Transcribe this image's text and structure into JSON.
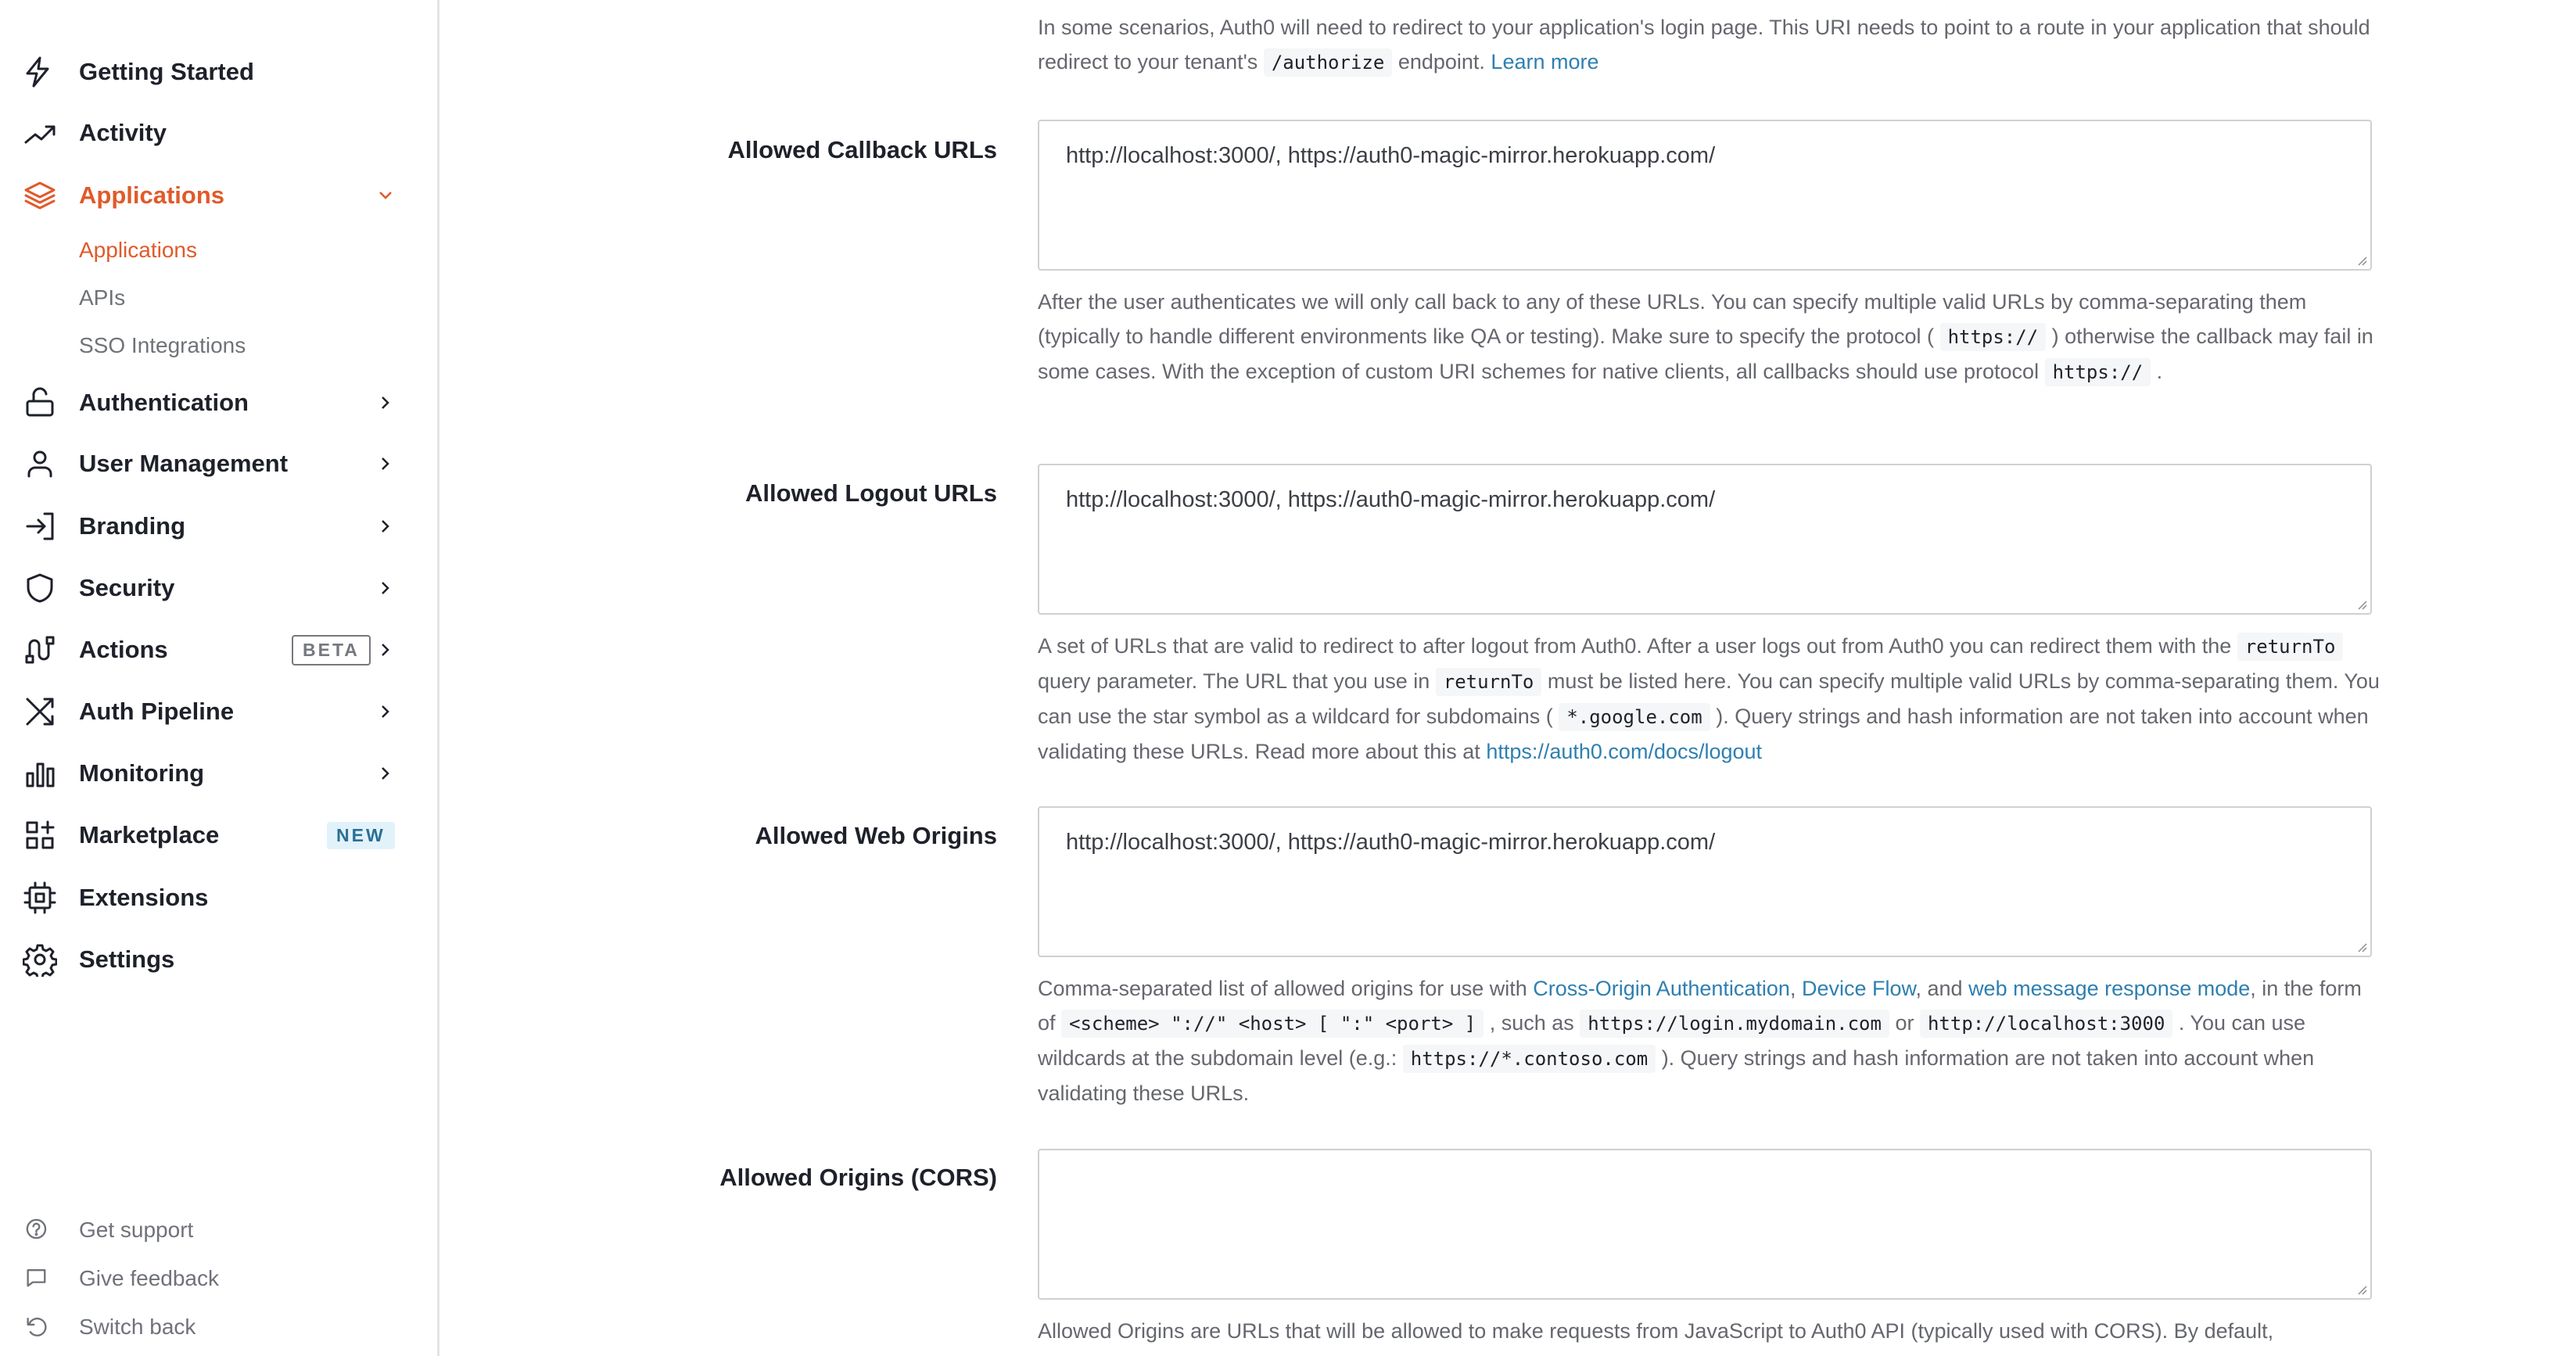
{
  "sidebar": {
    "items": [
      {
        "label": "Getting Started",
        "icon": "lightning-icon"
      },
      {
        "label": "Activity",
        "icon": "trending-up-icon"
      },
      {
        "label": "Applications",
        "icon": "layers-icon",
        "active": true
      },
      {
        "label": "Authentication",
        "icon": "lock-icon"
      },
      {
        "label": "User Management",
        "icon": "user-icon"
      },
      {
        "label": "Branding",
        "icon": "login-arrow-icon"
      },
      {
        "label": "Security",
        "icon": "shield-icon"
      },
      {
        "label": "Actions",
        "icon": "actions-flow-icon",
        "badge": "BETA"
      },
      {
        "label": "Auth Pipeline",
        "icon": "shuffle-icon"
      },
      {
        "label": "Monitoring",
        "icon": "bar-chart-icon"
      },
      {
        "label": "Marketplace",
        "icon": "grid-plus-icon",
        "badge": "NEW"
      },
      {
        "label": "Extensions",
        "icon": "chip-icon"
      },
      {
        "label": "Settings",
        "icon": "gear-icon"
      }
    ],
    "subitems": [
      {
        "label": "Applications",
        "active": true
      },
      {
        "label": "APIs"
      },
      {
        "label": "SSO Integrations"
      }
    ],
    "footer": [
      {
        "label": "Get support",
        "icon": "help-circle-icon"
      },
      {
        "label": "Give feedback",
        "icon": "message-icon"
      },
      {
        "label": "Switch back",
        "icon": "undo-icon"
      }
    ],
    "accent": "#e05a2a"
  },
  "main": {
    "intro": [
      {
        "t": "In some scenarios, Auth0 will need to redirect to your application's login page. This URI needs to point to a route in your application that should redirect to your tenant's "
      },
      {
        "t": "/authorize",
        "type": "code"
      },
      {
        "t": " endpoint. "
      },
      {
        "t": "Learn more",
        "type": "link"
      }
    ],
    "fields": [
      {
        "label": "Allowed Callback URLs",
        "value": "http://localhost:3000/, https://auth0-magic-mirror.herokuapp.com/",
        "description": [
          {
            "t": "After the user authenticates we will only call back to any of these URLs. You can specify multiple valid URLs by comma-separating them (typically to handle different environments like QA or testing). Make sure to specify the protocol ( "
          },
          {
            "t": "https://",
            "type": "code"
          },
          {
            "t": " ) otherwise the callback may fail in some cases. With the exception of custom URI schemes for native clients, all callbacks should use protocol "
          },
          {
            "t": "https://",
            "type": "code"
          },
          {
            "t": " ."
          }
        ]
      },
      {
        "label": "Allowed Logout URLs",
        "value": "http://localhost:3000/, https://auth0-magic-mirror.herokuapp.com/",
        "description": [
          {
            "t": "A set of URLs that are valid to redirect to after logout from Auth0. After a user logs out from Auth0 you can redirect them with the "
          },
          {
            "t": "returnTo",
            "type": "code"
          },
          {
            "t": " query parameter. The URL that you use in "
          },
          {
            "t": "returnTo",
            "type": "code"
          },
          {
            "t": " must be listed here. You can specify multiple valid URLs by comma-separating them. You can use the star symbol as a wildcard for subdomains ( "
          },
          {
            "t": "*.google.com",
            "type": "code"
          },
          {
            "t": " ). Query strings and hash information are not taken into account when validating these URLs. Read more about this at "
          },
          {
            "t": "https://auth0.com/docs/logout",
            "type": "link"
          }
        ]
      },
      {
        "label": "Allowed Web Origins",
        "value": "http://localhost:3000/, https://auth0-magic-mirror.herokuapp.com/",
        "description": [
          {
            "t": "Comma-separated list of allowed origins for use with "
          },
          {
            "t": "Cross-Origin Authentication",
            "type": "link"
          },
          {
            "t": ", "
          },
          {
            "t": "Device Flow",
            "type": "link"
          },
          {
            "t": ", and "
          },
          {
            "t": "web message response mode",
            "type": "link"
          },
          {
            "t": ", in the form of "
          },
          {
            "t": "<scheme> \"://\" <host> [ \":\" <port> ]",
            "type": "code"
          },
          {
            "t": " , such as "
          },
          {
            "t": "https://login.mydomain.com",
            "type": "code"
          },
          {
            "t": " or "
          },
          {
            "t": "http://localhost:3000",
            "type": "code"
          },
          {
            "t": " . You can use wildcards at the subdomain level (e.g.: "
          },
          {
            "t": "https://*.contoso.com",
            "type": "code"
          },
          {
            "t": " ). Query strings and hash information are not taken into account when validating these URLs."
          }
        ]
      },
      {
        "label": "Allowed Origins (CORS)",
        "value": "",
        "description": [
          {
            "t": "Allowed Origins are URLs that will be allowed to make requests from JavaScript to Auth0 API (typically used with CORS). By default,"
          }
        ]
      }
    ],
    "link_color": "#2e7fb0"
  }
}
